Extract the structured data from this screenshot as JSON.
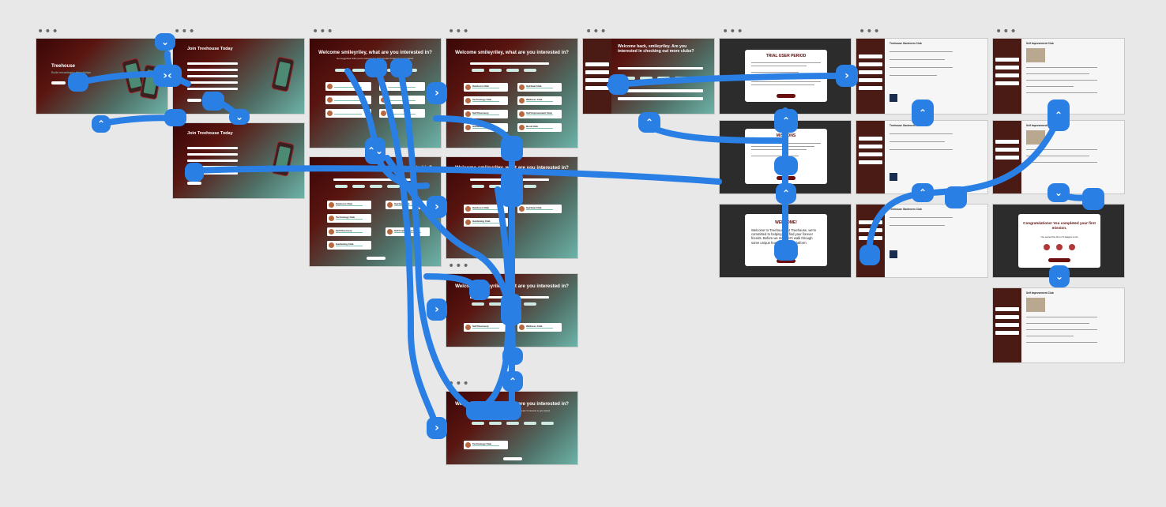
{
  "app": {
    "name": "Treehouse",
    "tagline": "Build meaningful friendships"
  },
  "frame_menu_glyph": "•••",
  "screens": {
    "landing": {
      "title": "Treehouse",
      "tagline": "Build meaningful friendships"
    },
    "signup": {
      "title": "Join Treehouse Today"
    },
    "signup_filled": {
      "title": "Join Treehouse Today"
    },
    "interests": {
      "title": "Welcome smileyriley, what are you interested in?",
      "subtitle": "Get suggested clubs you're interested in. Pick at least 3 interests to get started."
    },
    "interests_clubs": {
      "title": "Welcome smileyriley, what are you interested in?",
      "clubs": [
        "Outdoors Club",
        "Spiritual Club",
        "Technology Club",
        "Wellness Club",
        "Self Discovery",
        "Self Improvement Club",
        "Gardening Club",
        "Book Club"
      ]
    },
    "welcome_back": {
      "title": "Welcome back, smileyriley. Are you interested in checking out more clubs?"
    },
    "trial": {
      "title": "TRIAL USER PERIOD"
    },
    "missions": {
      "title": "MISSIONS"
    },
    "welcome_modal": {
      "title": "WELCOME!",
      "body": "Welcome to Treehouse! At Treehouse, we're committed to helping you find your forever friends. Before we start, let's walk through some unique features on our platform."
    },
    "club_page": {
      "title": "Treehouse Gardeners Club"
    },
    "self_improvement": {
      "title": "Self Improvement Club"
    },
    "congrats": {
      "title": "Congratulations! You completed your first mission.",
      "body": "You earned the first of 3 badges so far"
    }
  },
  "colors": {
    "flow": "#2a7fe5",
    "brand_dark": "#6b0e0e",
    "teal": "#6db3a8"
  }
}
